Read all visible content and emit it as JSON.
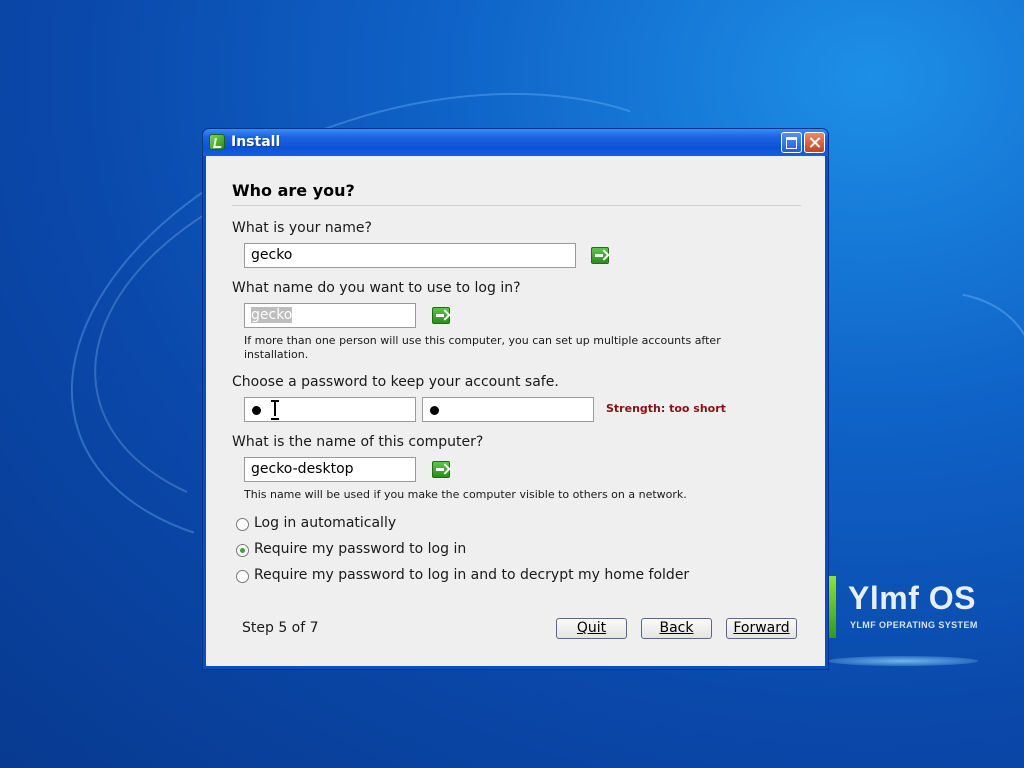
{
  "window": {
    "title": "Install"
  },
  "page": {
    "heading": "Who are you?"
  },
  "fields": {
    "name": {
      "label": "What is your name?",
      "value": "gecko"
    },
    "login": {
      "label": "What name do you want to use to log in?",
      "value": "gecko",
      "hint": "If more than one person will use this computer, you can set up multiple accounts after installation."
    },
    "password": {
      "label": "Choose a password to keep your account safe.",
      "strength": "Strength: too short"
    },
    "computer": {
      "label": "What is the name of this computer?",
      "value": "gecko-desktop",
      "hint": "This name will be used if you make the computer visible to others on a network."
    }
  },
  "login_options": [
    {
      "label": "Log in automatically",
      "selected": false
    },
    {
      "label": "Require my password to log in",
      "selected": true
    },
    {
      "label": "Require my password to log in and to decrypt my home folder",
      "selected": false
    }
  ],
  "footer": {
    "step": "Step 5 of 7",
    "quit": "Quit",
    "back": "Back",
    "forward": "Forward"
  },
  "brand": {
    "title": "Ylmf OS",
    "subtitle": "YLMF OPERATING SYSTEM"
  },
  "icons": {
    "app": "installer-icon",
    "go": "green-arrow-icon",
    "maximize": "maximize-icon",
    "close": "close-icon"
  },
  "colors": {
    "titlebar": "#0c53d6",
    "strength": "#8b1010",
    "radio_selected": "#3aa33a"
  }
}
